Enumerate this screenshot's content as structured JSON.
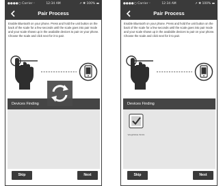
{
  "statusbar": {
    "carrier": "●●●●○ Carrier ᵕ",
    "time": "12:34 AM",
    "battery": "↗ ✱ 100% ▬"
  },
  "screens": [
    {
      "title": "Pair Process",
      "instructions": "Enable Bluetooth on your phone.  Press and hold the unit button on the back of the scale for a few seconds until the scale goes into pair mode and your scale shows up in the available devices to pair on your phone.  Choose the scale and click next for it to pair.",
      "devices_header": "Devices Finding",
      "skip_label": "Skip",
      "next_label": "Next",
      "state": "searching"
    },
    {
      "title": "Pair Process",
      "instructions": "Enable Bluetooth on your phone.  Press and hold the unit button on the back of the scale for a few seconds until the scale goes into pair mode and your scale shows up in the available devices to pair on your phone.  Choose the scale and click next for it to pair.",
      "devices_header": "Devices Finding",
      "skip_label": "Skip",
      "next_label": "Next",
      "state": "found",
      "devices": [
        {
          "name": "WeighWide W101",
          "icon": "scale-check-icon"
        }
      ]
    }
  ],
  "icons": {
    "back": "chevron-left-icon",
    "hand": "hand-pointing-icon",
    "phone": "smartphone-icon",
    "refresh": "refresh-icon"
  },
  "colors": {
    "bar": "#3a3a3a",
    "panel_header": "#454545",
    "panel_bg": "#e6e6e6",
    "button": "#3a3a3a"
  }
}
